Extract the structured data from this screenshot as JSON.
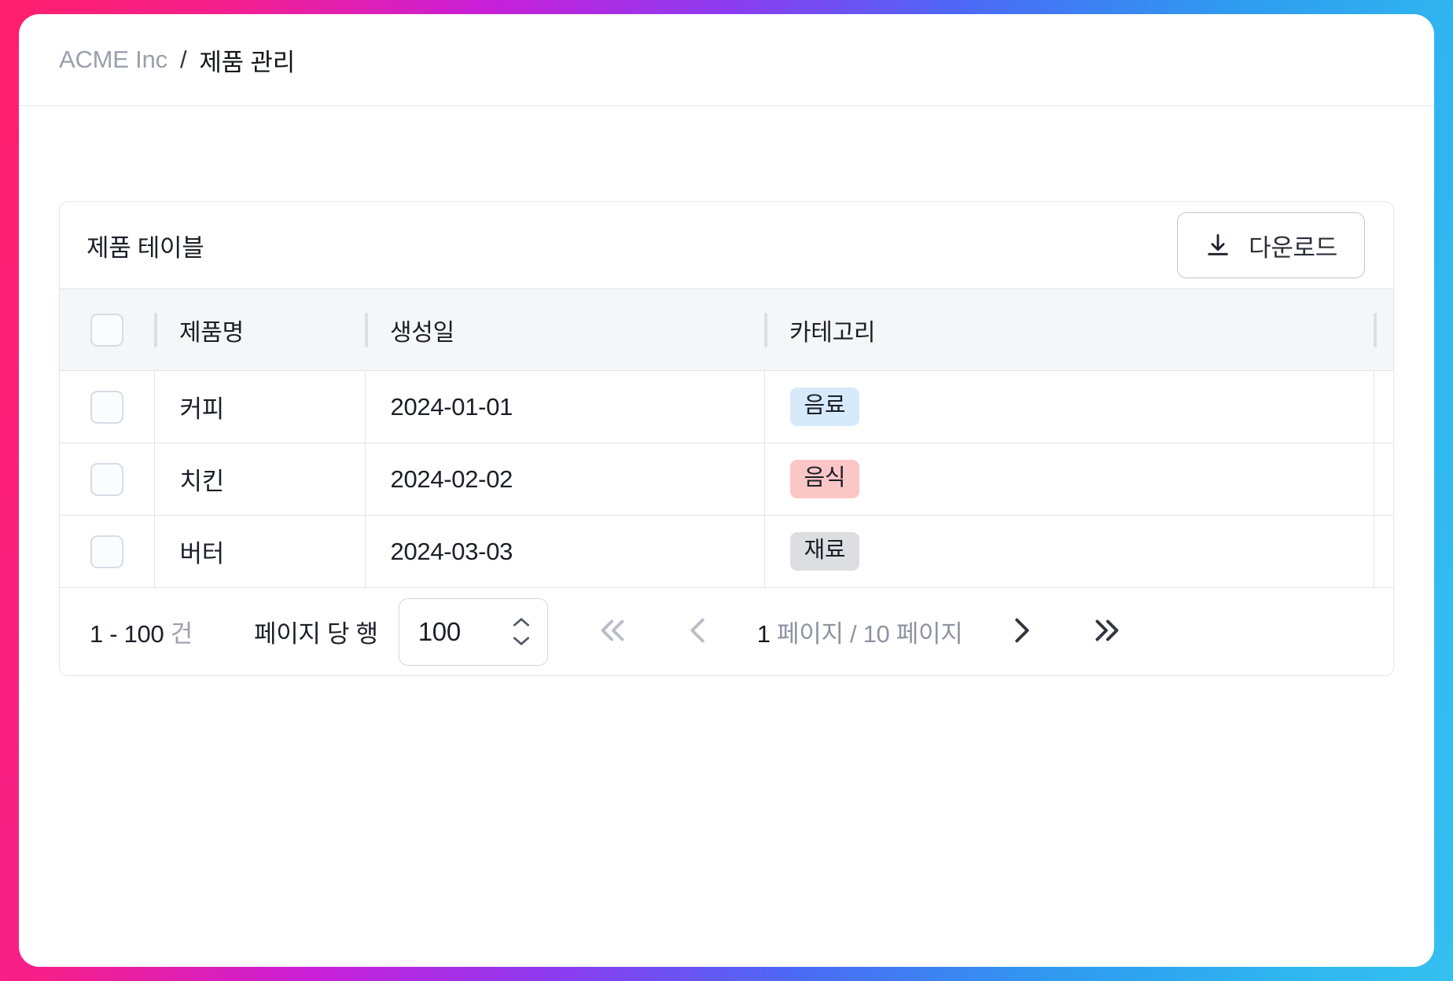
{
  "breadcrumb": {
    "org": "ACME Inc",
    "separator": "/",
    "current": "제품 관리"
  },
  "card": {
    "title": "제품 테이블",
    "download_label": "다운로드",
    "download_icon": "download-icon"
  },
  "table": {
    "columns": [
      {
        "key": "select",
        "label": ""
      },
      {
        "key": "name",
        "label": "제품명"
      },
      {
        "key": "created",
        "label": "생성일"
      },
      {
        "key": "category",
        "label": "카테고리"
      }
    ],
    "rows": [
      {
        "name": "커피",
        "created": "2024-01-01",
        "category": "음료",
        "category_color": "#d6eafb"
      },
      {
        "name": "치킨",
        "created": "2024-02-02",
        "category": "음식",
        "category_color": "#fbc6c6"
      },
      {
        "name": "버터",
        "created": "2024-03-03",
        "category": "재료",
        "category_color": "#dcdee2"
      }
    ]
  },
  "pagination": {
    "range_text": "1 - 100",
    "range_unit": "건",
    "rows_per_page_label": "페이지 당 행",
    "rows_per_page_value": "100",
    "current_page": "1",
    "page_text": "페이지 / 10 페이지",
    "first_icon": "chevrons-left-icon",
    "prev_icon": "chevron-left-icon",
    "next_icon": "chevron-right-icon",
    "last_icon": "chevrons-right-icon"
  },
  "colors": {
    "date_text": "#1b2a5e",
    "muted": "#9aa0ac",
    "border": "#e1e3e8",
    "header_bg": "#f5f6f7"
  }
}
